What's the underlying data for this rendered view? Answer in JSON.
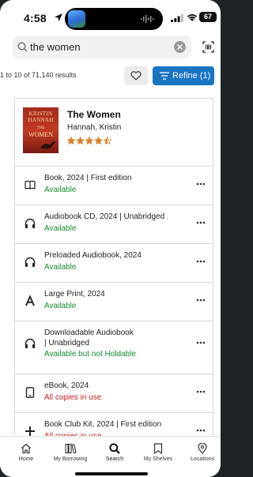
{
  "status_bar": {
    "time": "4:58",
    "battery": "67"
  },
  "search": {
    "query": "the women"
  },
  "results": {
    "count_text": "1 to 10 of 71,140 results",
    "refine_label": "Refine (1)"
  },
  "book": {
    "title": "The Women",
    "author": "Hannah, Kristin",
    "rating": 4.5,
    "rating_max": 5,
    "cover_text": [
      "KRISTIN",
      "HANNAH",
      "THE",
      "WOMEN"
    ]
  },
  "formats": [
    {
      "line1": "Book, 2024 | First edition",
      "line2": "",
      "status": "Available",
      "status_type": "available",
      "icon": "book-icon"
    },
    {
      "line1": "Audiobook CD, 2024 | Unabridged",
      "line2": "",
      "status": "Available",
      "status_type": "available",
      "icon": "headphones-icon"
    },
    {
      "line1": "Preloaded Audiobook, 2024",
      "line2": "",
      "status": "Available",
      "status_type": "available",
      "icon": "headphones-icon"
    },
    {
      "line1": "Large Print, 2024",
      "line2": "",
      "status": "Available",
      "status_type": "available",
      "icon": "large-print-icon"
    },
    {
      "line1": "Downloadable Audiobook",
      "line2": "| Unabridged",
      "status": "Available but not Holdable",
      "status_type": "available",
      "icon": "headphones-icon"
    },
    {
      "line1": "eBook, 2024",
      "line2": "",
      "status": "All copies in use",
      "status_type": "inuse",
      "icon": "tablet-icon"
    },
    {
      "line1": "Book Club Kit, 2024 | First edition",
      "line2": "",
      "status": "All copies in use",
      "status_type": "inuse",
      "icon": "plus-icon"
    }
  ],
  "tabs": [
    {
      "label": "Home",
      "icon": "home-icon"
    },
    {
      "label": "My Borrowing",
      "icon": "books-icon"
    },
    {
      "label": "Search",
      "icon": "search-icon"
    },
    {
      "label": "My Shelves",
      "icon": "bookmark-icon"
    },
    {
      "label": "Locations",
      "icon": "location-pin-icon"
    }
  ],
  "colors": {
    "accent": "#1a74c4",
    "available": "#188a2f",
    "in_use": "#c81e1e",
    "star": "#d9822b"
  }
}
